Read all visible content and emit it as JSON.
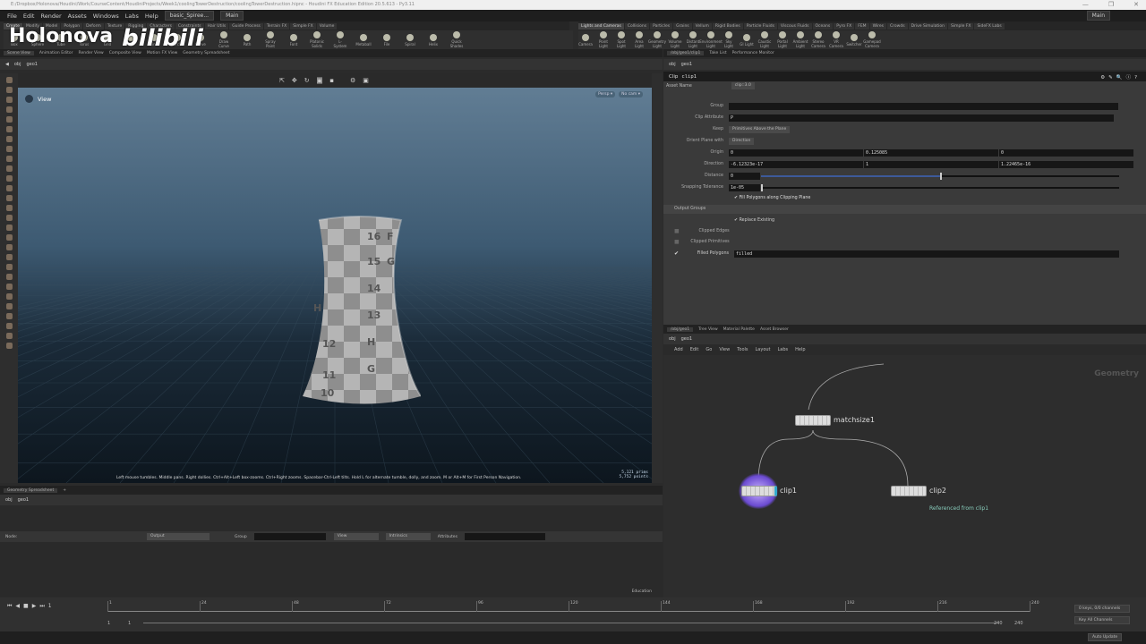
{
  "window": {
    "title": "E:/Dropbox/Holonova/Houdini/Work/CourseContent/HoudiniProjects/Week1/coolingTowerDestruction/coolingTowerDestruction.hipnc - Houdini FX Education Edition 20.5.613 - Py3.11",
    "minimize": "—",
    "maximize": "❐",
    "close": "✕"
  },
  "watermark": {
    "text": "Holonova",
    "logo": "bilibili"
  },
  "menu": [
    "File",
    "Edit",
    "Render",
    "Assets",
    "Windows",
    "Labs",
    "Help"
  ],
  "desktop": "basic_Spiree...",
  "desktop_right": "Main",
  "desktop_right2": "Main",
  "shelf_left": {
    "tabs": [
      "Create",
      "Modify",
      "Model",
      "Polygon",
      "Deform",
      "Texture",
      "Rigging",
      "Characters",
      "Constraints",
      "Hair Utils",
      "Guide Process",
      "Terrain FX",
      "Simple FX",
      "Volume"
    ],
    "tools": [
      "Box",
      "Sphere",
      "Tube",
      "Torus",
      "Grid",
      "Null",
      "Line",
      "Circle",
      "Curve",
      "Draw Curve",
      "Path",
      "Spray Paint",
      "Font",
      "Platonic Solids",
      "L-System",
      "Metaball",
      "File",
      "Spiral",
      "Helix",
      "Quick Shades"
    ]
  },
  "shelf_right": {
    "tabs": [
      "Lights and Cameras",
      "Collisions",
      "Particles",
      "Grains",
      "Vellum",
      "Rigid Bodies",
      "Particle Fluids",
      "Viscous Fluids",
      "Oceans",
      "Pyro FX",
      "FEM",
      "Wires",
      "Crowds",
      "Drive Simulation",
      "Simple FX",
      "SideFX Labs"
    ],
    "tools": [
      "Camera",
      "Point Light",
      "Spot Light",
      "Area Light",
      "Geometry Light",
      "Volume Light",
      "Distant Light",
      "Environment Light",
      "Sky Light",
      "GI Light",
      "Caustic Light",
      "Portal Light",
      "Ambient Light",
      "Stereo Camera",
      "VR Camera",
      "Switcher",
      "Gamepad Camera"
    ]
  },
  "left_panes": {
    "tabs": [
      "Scene View",
      "Animation Editor",
      "Render View",
      "Composite View",
      "Motion FX View",
      "Geometry Spreadsheet"
    ]
  },
  "path": {
    "obj": "obj",
    "geo": "geo1"
  },
  "viewport": {
    "label": "View",
    "persp": "Persp ▾",
    "cam": "No cam ▾",
    "hint": "Left mouse tumbles. Middle pans. Right dollies. Ctrl+Alt+Left box-zooms. Ctrl+Right zooms. Spacebar-Ctrl-Left tilts. Hold L for alternate tumble, dolly, and zoom. M or Alt+M for First Person Navigation.",
    "stats": [
      "5,121  prims",
      "5,752  points"
    ],
    "uv_labels": [
      "16",
      "F",
      "15",
      "G",
      "14",
      "H",
      "13",
      "12",
      "H",
      "11",
      "G",
      "10"
    ]
  },
  "spreadsheet": {
    "tab": "Geometry Spreadsheet",
    "node_label": "Node:",
    "output": "Output",
    "group": "Group",
    "view": "View",
    "intrinsics": "Intrinsics",
    "attributes": "Attributes",
    "education": "Education"
  },
  "right_panes": {
    "tabs": [
      "/obj/geo1/clip1",
      "Take List",
      "Performance Monitor"
    ]
  },
  "params": {
    "type": "Clip",
    "name": "clip1",
    "asset_label": "Asset Name",
    "asset_value": "clip::3.0",
    "rows": [
      {
        "label": "Group",
        "value": ""
      },
      {
        "label": "Clip Attribute",
        "value": "P"
      },
      {
        "label": "Keep",
        "value": "Primitives Above the Plane"
      },
      {
        "label": "Orient Plane with",
        "value": "Direction"
      },
      {
        "label": "Origin",
        "values": [
          "0",
          "0.125085",
          "0"
        ]
      },
      {
        "label": "Direction",
        "values": [
          "-6.12323e-17",
          "1",
          "1.22465e-16"
        ]
      },
      {
        "label": "Distance",
        "value": "0",
        "slider": 0.5
      },
      {
        "label": "Snapping Tolerance",
        "value": "1e-05",
        "slider": 0.0
      }
    ],
    "fill_polygons": "Fill Polygons along Clipping Plane",
    "output_groups": "Output Groups",
    "replace_existing": "Replace Existing",
    "clipped_edges": "Clipped Edges",
    "clipped_primitives": "Clipped Primitives",
    "filled_polygons": "Filled Polygons",
    "filled_value": "filled"
  },
  "network": {
    "tabs": [
      "/obj/geo1",
      "Tree View",
      "Material Palette",
      "Asset Browser"
    ],
    "menu": [
      "Add",
      "Edit",
      "Go",
      "View",
      "Tools",
      "Layout",
      "Labs",
      "Help"
    ],
    "context": "Geometry",
    "nodes": [
      {
        "name": "matchsize1"
      },
      {
        "name": "clip1"
      },
      {
        "name": "clip2",
        "note": "Referenced from clip1"
      }
    ]
  },
  "timeline": {
    "frame": "1",
    "start": "1",
    "start2": "1",
    "end": "240",
    "end2": "240",
    "ticks": [
      "1",
      "24",
      "48",
      "72",
      "96",
      "120",
      "144",
      "168",
      "192",
      "216",
      "240"
    ],
    "keys": "0 keys, 0/0 channels",
    "key_all": "Key All Channels",
    "auto_update": "Auto Update"
  }
}
